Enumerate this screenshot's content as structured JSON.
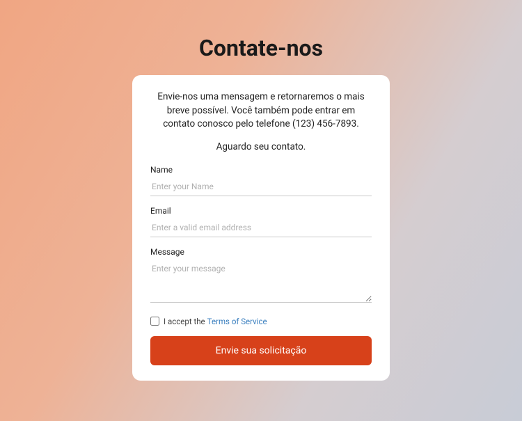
{
  "title": "Contate-nos",
  "intro": "Envie-nos uma mensagem e retornaremos o mais breve possível. Você também pode entrar em contato conosco pelo telefone (123) 456-7893.",
  "wait": "Aguardo seu contato.",
  "fields": {
    "name": {
      "label": "Name",
      "placeholder": "Enter your Name"
    },
    "email": {
      "label": "Email",
      "placeholder": "Enter a valid email address"
    },
    "message": {
      "label": "Message",
      "placeholder": "Enter your message"
    }
  },
  "terms": {
    "prefix": "I accept the ",
    "link": "Terms of Service"
  },
  "submit": "Envie sua solicitação"
}
